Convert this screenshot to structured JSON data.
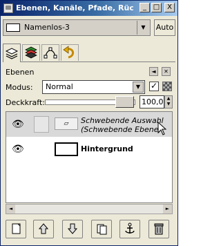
{
  "window": {
    "title": "Ebenen, Kanäle, Pfade, Rückg...",
    "controls": {
      "minimize": "_",
      "maximize": "□",
      "close": "X"
    }
  },
  "image_selector": {
    "value": "Namenlos-3",
    "auto_label": "Auto"
  },
  "tabs": [
    "layers-tab-icon",
    "channels-tab-icon",
    "paths-tab-icon",
    "undo-history-tab-icon"
  ],
  "panel": {
    "title": "Ebenen",
    "menu_symbol": "◄",
    "close_symbol": "✕"
  },
  "mode": {
    "label": "Modus:",
    "value": "Normal"
  },
  "opacity": {
    "label": "Deckkraft:",
    "value": "100,0",
    "level": 1.0
  },
  "layers": [
    {
      "name_line1": "Schwebende Auswahl",
      "name_line2": "(Schwebende Ebene)",
      "visible": true
    },
    {
      "name": "Hintergrund",
      "visible": true
    }
  ],
  "bottom_buttons": [
    "new-layer-icon",
    "raise-layer-icon",
    "lower-layer-icon",
    "duplicate-layer-icon",
    "anchor-layer-icon",
    "delete-layer-icon"
  ],
  "colors": {
    "title_dark": "#0a246a",
    "title_light": "#a6caf0",
    "panel_bg": "#ece9d8",
    "selected_row": "#d9d9d9"
  }
}
